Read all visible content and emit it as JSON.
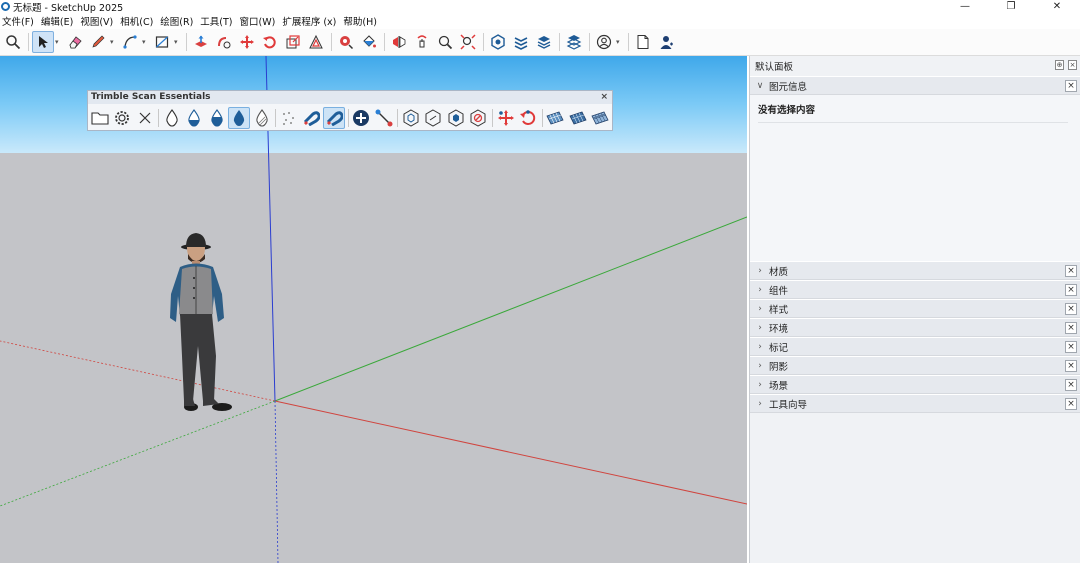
{
  "window": {
    "title": "无标题 - SketchUp 2025",
    "controls": [
      "—",
      "❐",
      "✕"
    ]
  },
  "menubar": [
    "文件(F)",
    "编辑(E)",
    "视图(V)",
    "相机(C)",
    "绘图(R)",
    "工具(T)",
    "窗口(W)",
    "扩展程序 (x)",
    "帮助(H)"
  ],
  "toolbar": {
    "tools": [
      "search",
      "select",
      "eraser",
      "pencil",
      "line",
      "rectangle",
      "pushpull",
      "follow-me",
      "move",
      "rotate",
      "scale",
      "offset",
      "tape",
      "paint",
      "flip",
      "orbit",
      "zoom",
      "zoom-extents",
      "warehouse",
      "extension",
      "layers",
      "components",
      "user",
      "new-doc",
      "account"
    ]
  },
  "float_toolbar": {
    "title": "Trimble Scan Essentials",
    "close": "×"
  },
  "panel": {
    "title": "默认面板",
    "entity_info": {
      "label": "图元信息",
      "body": "没有选择内容"
    },
    "trays": [
      {
        "label": "材质"
      },
      {
        "label": "组件"
      },
      {
        "label": "样式"
      },
      {
        "label": "环境"
      },
      {
        "label": "标记"
      },
      {
        "label": "阴影"
      },
      {
        "label": "场景"
      },
      {
        "label": "工具向导"
      }
    ],
    "close_glyph": "×",
    "collapsed_chevron": "›",
    "expanded_chevron": "∨"
  },
  "colors": {
    "sky_top": "#3fa8ea",
    "ground": "#c3c4c8",
    "axis_red": "#d0453f",
    "axis_green": "#3aa83a",
    "axis_blue": "#2a3dd0"
  }
}
